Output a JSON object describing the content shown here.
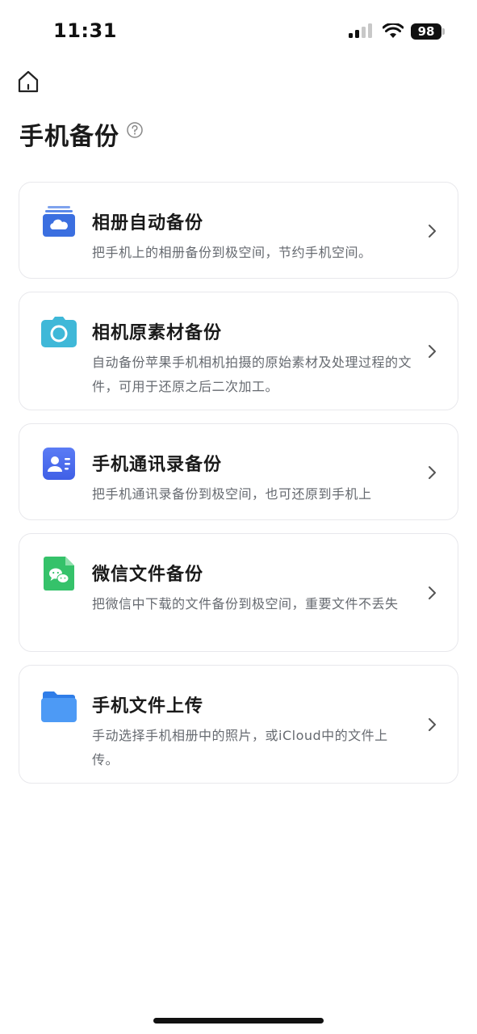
{
  "status_bar": {
    "time": "11:31",
    "battery": "98"
  },
  "header": {
    "title": "手机备份"
  },
  "cards": [
    {
      "title": "相册自动备份",
      "description": "把手机上的相册备份到极空间，节约手机空间。",
      "icon": "photo-album-cloud-icon",
      "icon_color": "#3b6fe0"
    },
    {
      "title": "相机原素材备份",
      "description": "自动备份苹果手机相机拍摄的原始素材及处理过程的文件，可用于还原之后二次加工。",
      "icon": "camera-icon",
      "icon_color": "#3fb8d8"
    },
    {
      "title": "手机通讯录备份",
      "description": "把手机通讯录备份到极空间，也可还原到手机上",
      "icon": "contacts-icon",
      "icon_color": "#4a6cf0"
    },
    {
      "title": "微信文件备份",
      "description": "把微信中下载的文件备份到极空间，重要文件不丢失",
      "icon": "wechat-file-icon",
      "icon_color": "#35c26a"
    },
    {
      "title": "手机文件上传",
      "description": "手动选择手机相册中的照片，或iCloud中的文件上传。",
      "icon": "folder-icon",
      "icon_color": "#3d8ef0"
    }
  ]
}
